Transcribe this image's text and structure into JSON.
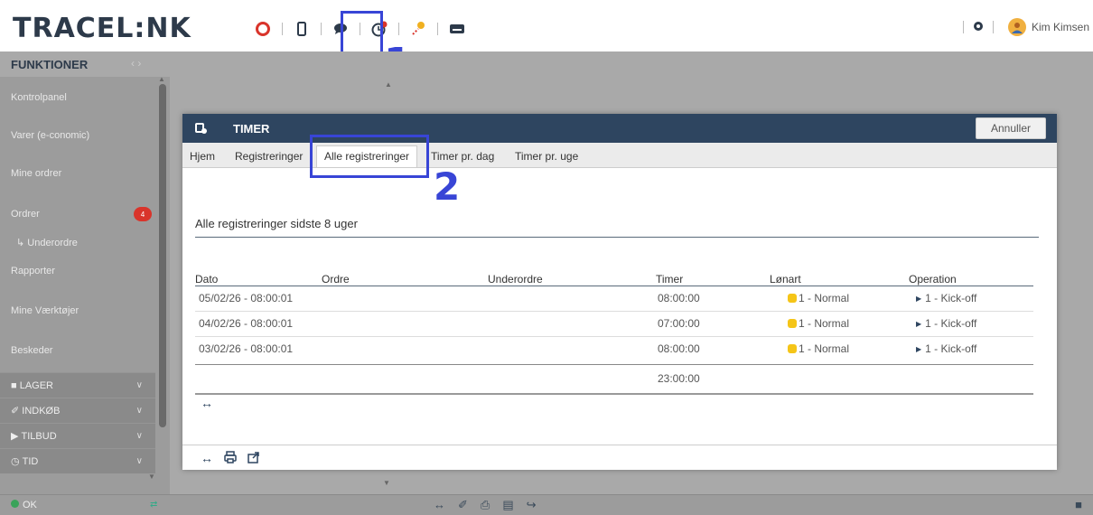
{
  "app": {
    "logo": "TRACEL:NK"
  },
  "topbar": {
    "icons": [
      "lifebuoy-icon",
      "mobile-icon",
      "chat-icon",
      "clock-icon",
      "map-pin-icon",
      "keyboard-icon"
    ],
    "user_name": "Kim Kimsen"
  },
  "annotations": {
    "step1": "1",
    "step2": "2"
  },
  "sidebar": {
    "header": "FUNKTIONER",
    "items": [
      {
        "label": "Kontrolpanel"
      },
      {
        "label": "Varer (e-conomic)"
      },
      {
        "label": "Mine ordrer"
      },
      {
        "label": "Ordrer",
        "badge": "4"
      },
      {
        "label": "↳ Underordre"
      },
      {
        "label": "Rapporter"
      },
      {
        "label": "Mine Værktøjer"
      },
      {
        "label": "Beskeder"
      }
    ],
    "groups": [
      {
        "label": "LAGER"
      },
      {
        "label": "INDKØB"
      },
      {
        "label": "TILBUD"
      },
      {
        "label": "TID"
      }
    ]
  },
  "statusbar": {
    "status": "OK"
  },
  "dialog": {
    "title": "TIMER",
    "cancel_label": "Annuller",
    "tabs": [
      {
        "label": "Hjem"
      },
      {
        "label": "Registreringer"
      },
      {
        "label": "Alle registreringer"
      },
      {
        "label": "Timer pr. dag"
      },
      {
        "label": "Timer pr. uge"
      }
    ],
    "section_title": "Alle registreringer sidste 8 uger",
    "table": {
      "headers": [
        "Dato",
        "Ordre",
        "Underordre",
        "Timer",
        "Lønart",
        "Operation"
      ],
      "rows": [
        {
          "dato": "05/02/26 - 08:00:01",
          "ordre": "",
          "underordre": "",
          "timer": "08:00:00",
          "lonart": "1 - Normal",
          "operation": "1 - Kick-off"
        },
        {
          "dato": "04/02/26 - 08:00:01",
          "ordre": "",
          "underordre": "",
          "timer": "07:00:00",
          "lonart": "1 - Normal",
          "operation": "1 - Kick-off"
        },
        {
          "dato": "03/02/26 - 08:00:01",
          "ordre": "",
          "underordre": "",
          "timer": "08:00:00",
          "lonart": "1 - Normal",
          "operation": "1 - Kick-off"
        }
      ],
      "total": "23:00:00"
    },
    "colors": {
      "header_bg": "#2e4560",
      "highlight": "#3845d6",
      "lonart_dot": "#f5c518"
    }
  }
}
